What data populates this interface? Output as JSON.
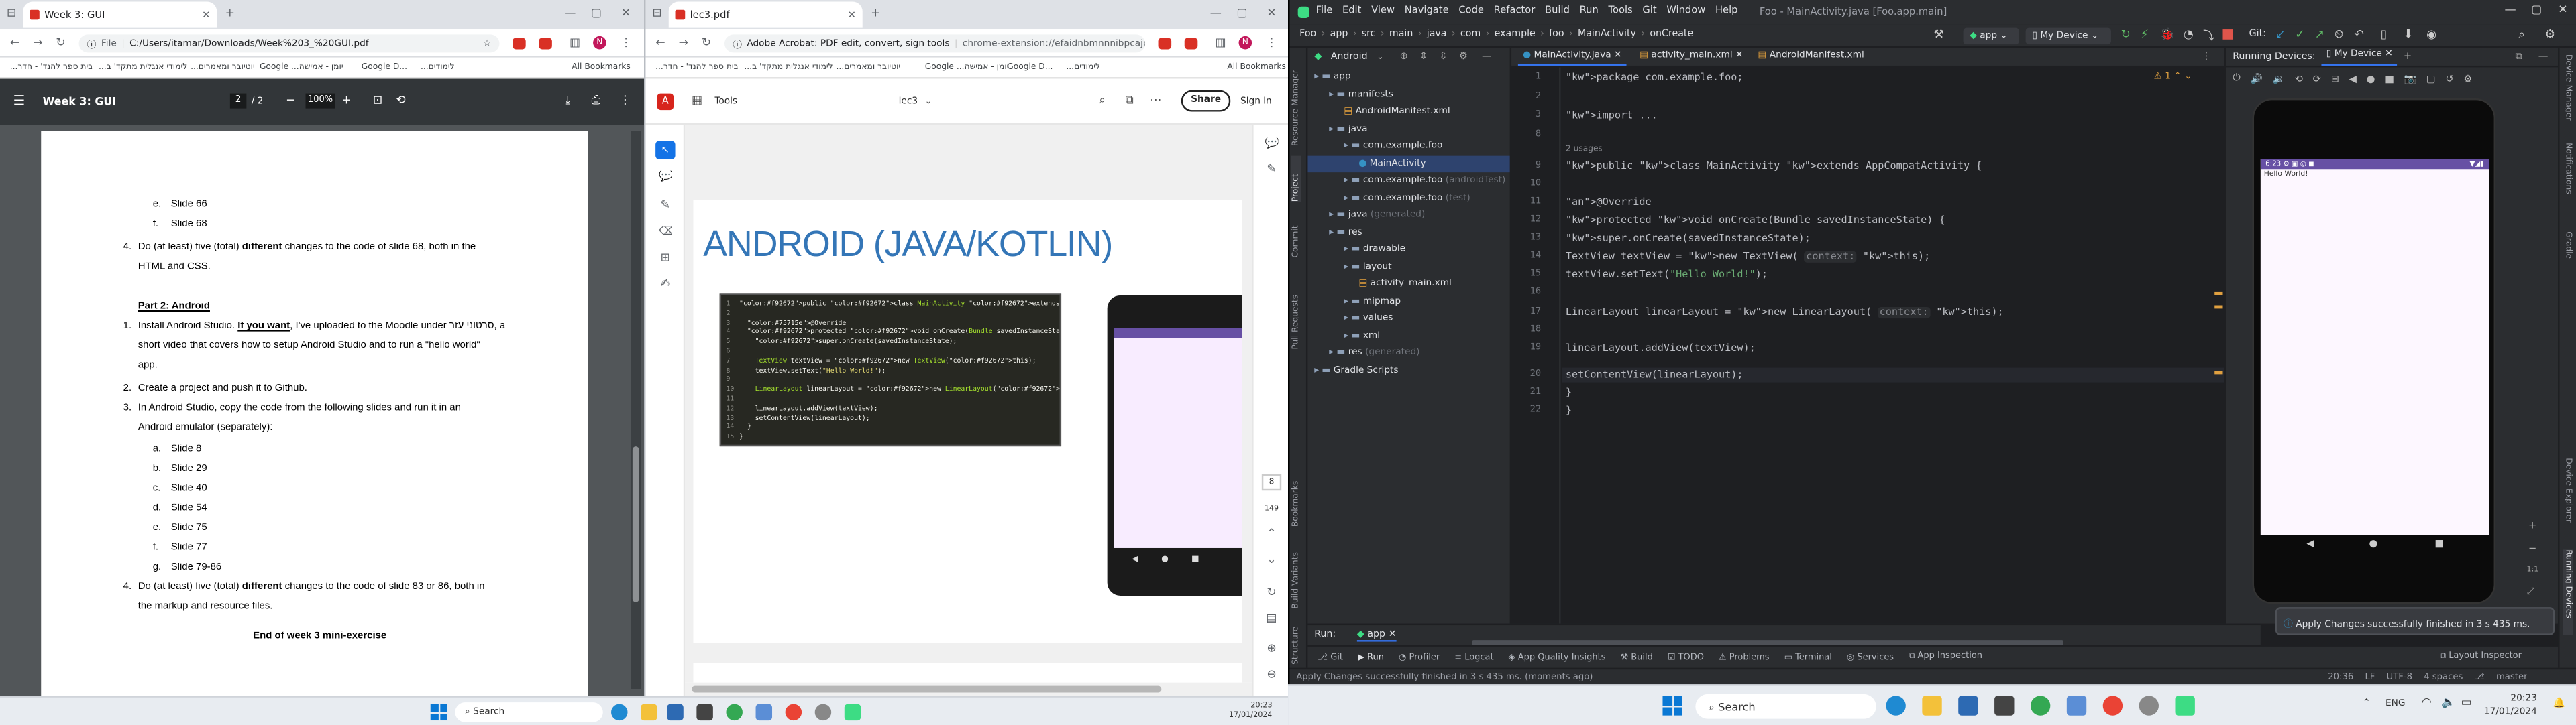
{
  "left_window": {
    "tab_title": "Week 3: GUI",
    "address": "C:/Users/itamar/Downloads/Week%203_%20GUI.pdf",
    "address_prefix": "File",
    "bookmarks": [
      "...בית ספר להנד' - חדר",
      "...לימודי אנגלית מתקד' ב",
      "...יוטיובר ומאמרים",
      "Google ...יומן - אמישה",
      "Google D...",
      "...לימודים",
      "All Bookmarks"
    ],
    "pdf_title": "Week 3: GUI",
    "page_current": "2",
    "page_total": "/ 2",
    "zoom": "100%",
    "lines": {
      "e1": "e.",
      "e1t": "Slide 66",
      "f1": "f.",
      "f1t": "Slide 68",
      "q4a": "4.",
      "q4a_1": "Do (at least) five (total) ",
      "q4a_b": "different",
      "q4a_2": " changes to the code of slide 68, both in the",
      "q4a_3": "HTML and CSS.",
      "part2": "Part 2: Android",
      "n1": "1.",
      "n1_1": "Install Android Studio. ",
      "n1_b": "If you want",
      "n1_2": ", I've uploaded to the Moodle under ",
      "n1_heb": "סרטוני עזר",
      "n1_3": ", a",
      "n1_4": "short video that covers how to setup Android Studio and to run a \"hello world\"",
      "n1_5": "app.",
      "n2": "2.",
      "n2_1": "Create a project and push it to Github.",
      "n3": "3.",
      "n3_1": "In Android Studio, copy the code from the following slides and run it in an",
      "n3_2": "Android emulator (separately):",
      "subs": [
        {
          "l": "a.",
          "t": "Slide 8"
        },
        {
          "l": "b.",
          "t": "Slide 29"
        },
        {
          "l": "c.",
          "t": "Slide 40"
        },
        {
          "l": "d.",
          "t": "Slide 54"
        },
        {
          "l": "e.",
          "t": "Slide 75"
        },
        {
          "l": "f.",
          "t": "Slide 77"
        },
        {
          "l": "g.",
          "t": "Slide 79-86"
        }
      ],
      "n4": "4.",
      "n4_1": "Do (at least) five (total) ",
      "n4_b": "different",
      "n4_2": " changes to the code of slide 83 or 86, both in",
      "n4_3": "the markup and resource files.",
      "end": "End of week 3 mini-exercise"
    }
  },
  "mid_window": {
    "tab_title": "lec3.pdf",
    "address_prefix": "Adobe Acrobat: PDF edit, convert, sign tools",
    "address": "chrome-extension://efaidnbmnnnibpcajpcglcle...",
    "bookmarks": [
      "...בית ספר להנד' - חדר",
      "...לימודי אנגלית מתקד' ב",
      "...יוטיובר ומאמרים",
      "Google ...יומן - אמישה",
      "Google D...",
      "...לימודים",
      "All Bookmarks"
    ],
    "tools_label": "Tools",
    "doc_name": "lec3",
    "share": "Share",
    "signin": "Sign in",
    "slide_title": "ANDROID (JAVA/KOTLIN)",
    "code_lines": [
      {
        "n": "1",
        "t": "public class MainActivity extends Activity {"
      },
      {
        "n": "2",
        "t": ""
      },
      {
        "n": "3",
        "t": "  @Override"
      },
      {
        "n": "4",
        "t": "  protected void onCreate(Bundle savedInstanceState) {"
      },
      {
        "n": "5",
        "t": "    super.onCreate(savedInstanceState);"
      },
      {
        "n": "6",
        "t": ""
      },
      {
        "n": "7",
        "t": "    TextView textView = new TextView(this);"
      },
      {
        "n": "8",
        "t": "    textView.setText(\"Hello World!\");"
      },
      {
        "n": "9",
        "t": ""
      },
      {
        "n": "10",
        "t": "    LinearLayout linearLayout = new LinearLayout(this);"
      },
      {
        "n": "11",
        "t": ""
      },
      {
        "n": "12",
        "t": "    linearLayout.addView(textView);"
      },
      {
        "n": "13",
        "t": "    setContentView(linearLayout);"
      },
      {
        "n": "14",
        "t": "  }"
      },
      {
        "n": "15",
        "t": "}"
      }
    ],
    "page_num": "8",
    "page_total": "149"
  },
  "studio": {
    "menus": [
      "File",
      "Edit",
      "View",
      "Navigate",
      "Code",
      "Refactor",
      "Build",
      "Run",
      "Tools",
      "Git",
      "Window",
      "Help"
    ],
    "title": "Foo - MainActivity.java [Foo.app.main]",
    "breadcrumb": [
      "Foo",
      "app",
      "src",
      "main",
      "java",
      "com",
      "example",
      "foo",
      "MainActivity",
      "onCreate"
    ],
    "run_config": "app",
    "device": "My Device",
    "git_label": "Git:",
    "project_view": "Android",
    "tree": [
      {
        "t": "app",
        "d": 0
      },
      {
        "t": "manifests",
        "d": 1
      },
      {
        "t": "AndroidManifest.xml",
        "d": 2
      },
      {
        "t": "java",
        "d": 1
      },
      {
        "t": "com.example.foo",
        "d": 2
      },
      {
        "t": "MainActivity",
        "d": 3,
        "sel": true
      },
      {
        "t": "com.example.foo",
        "d": 2,
        "hint": "(androidTest)"
      },
      {
        "t": "com.example.foo",
        "d": 2,
        "hint": "(test)"
      },
      {
        "t": "java",
        "d": 1,
        "hint": "(generated)"
      },
      {
        "t": "res",
        "d": 1
      },
      {
        "t": "drawable",
        "d": 2
      },
      {
        "t": "layout",
        "d": 2
      },
      {
        "t": "activity_main.xml",
        "d": 3
      },
      {
        "t": "mipmap",
        "d": 2
      },
      {
        "t": "values",
        "d": 2
      },
      {
        "t": "xml",
        "d": 2
      },
      {
        "t": "res",
        "d": 1,
        "hint": "(generated)"
      },
      {
        "t": "Gradle Scripts",
        "d": 0
      }
    ],
    "editor_tabs": [
      "MainActivity.java",
      "activity_main.xml",
      "AndroidManifest.xml"
    ],
    "warnings": "1",
    "usages": "2 usages",
    "code": [
      {
        "n": "1",
        "t": "package com.example.foo;"
      },
      {
        "n": "2",
        "t": ""
      },
      {
        "n": "3",
        "t": "import ..."
      },
      {
        "n": "8",
        "t": ""
      },
      {
        "n": "9",
        "t": "public class MainActivity extends AppCompatActivity {"
      },
      {
        "n": "10",
        "t": ""
      },
      {
        "n": "11",
        "t": "    @Override"
      },
      {
        "n": "12",
        "t": "    protected void onCreate(Bundle savedInstanceState) {"
      },
      {
        "n": "13",
        "t": "        super.onCreate(savedInstanceState);"
      },
      {
        "n": "14",
        "t": "        TextView textView = new TextView( context: this);"
      },
      {
        "n": "15",
        "t": "        textView.setText(\"Hello World!\");"
      },
      {
        "n": "16",
        "t": ""
      },
      {
        "n": "17",
        "t": "        LinearLayout linearLayout = new LinearLayout( context: this);"
      },
      {
        "n": "18",
        "t": ""
      },
      {
        "n": "19",
        "t": "        linearLayout.addView(textView);"
      },
      {
        "n": "20",
        "t": "        setContentView(linearLayout);"
      },
      {
        "n": "21",
        "t": "    }"
      },
      {
        "n": "22",
        "t": "}"
      }
    ],
    "running_devices": "Running Devices:",
    "device_tab": "My Device",
    "phone_time": "6:23",
    "phone_text": "Hello World!",
    "notification": "Apply Changes successfully finished in 3 s 435 ms.",
    "run_label": "Run:",
    "run_target": "app",
    "bottom_tabs": [
      "Git",
      "Run",
      "Profiler",
      "Logcat",
      "App Quality Insights",
      "Build",
      "TODO",
      "Problems",
      "Terminal",
      "Services",
      "App Inspection"
    ],
    "layout_inspector": "Layout Inspector",
    "status": "Apply Changes successfully finished in 3 s 435 ms. (moments ago)",
    "status_right": [
      "20:36",
      "LF",
      "UTF-8",
      "4 spaces",
      "master"
    ],
    "left_strip": [
      "Resource Manager",
      "Project",
      "Commit",
      "Pull Requests",
      "Bookmarks",
      "Build Variants",
      "Structure"
    ],
    "right_strip": [
      "Device Manager",
      "Notifications",
      "Gradle",
      "Device Explorer",
      "Running Devices"
    ]
  },
  "taskbar_left": {
    "search": "Search",
    "time": "20:23",
    "date": "17/01/2024"
  },
  "taskbar_right": {
    "search": "Search",
    "lang": "ENG",
    "time": "20:23",
    "date": "17/01/2024"
  }
}
